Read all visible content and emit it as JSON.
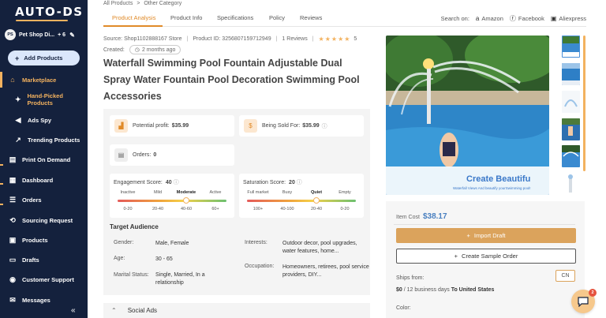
{
  "brand": {
    "logo_text": "AUTO-DS"
  },
  "store": {
    "avatar_text": "PS",
    "name": "Pet Shop Di...",
    "extra_count": "+ 6"
  },
  "sidebar": {
    "add_products": "Add Products",
    "items": [
      {
        "label": "Marketplace",
        "icon": "shop-icon"
      },
      {
        "label": "Hand-Picked Products",
        "icon": "star-icon"
      },
      {
        "label": "Ads Spy",
        "icon": "megaphone-icon"
      },
      {
        "label": "Trending Products",
        "icon": "trend-icon"
      },
      {
        "label": "Print On Demand",
        "icon": "printer-icon"
      },
      {
        "label": "Dashboard",
        "icon": "dashboard-icon"
      },
      {
        "label": "Orders",
        "icon": "orders-icon"
      },
      {
        "label": "Sourcing Request",
        "icon": "sourcing-icon"
      },
      {
        "label": "Products",
        "icon": "box-icon"
      },
      {
        "label": "Drafts",
        "icon": "drafts-icon"
      },
      {
        "label": "Customer Support",
        "icon": "support-icon"
      },
      {
        "label": "Messages",
        "icon": "message-icon"
      }
    ],
    "collapse_icon": "«"
  },
  "breadcrumb": {
    "items": [
      "All Products",
      ">",
      "Other Category"
    ]
  },
  "tabs": [
    "Product Analysis",
    "Product Info",
    "Specifications",
    "Policy",
    "Reviews"
  ],
  "search_on": {
    "label": "Search on:",
    "links": [
      "Amazon",
      "Facebook",
      "Aliexpress"
    ]
  },
  "meta": {
    "source": "Source: Shop1102888167 Store",
    "product_id": "Product ID: 3256807159712949",
    "reviews": "1 Reviews",
    "stars": "★★★★★",
    "rating": "5",
    "created_label": "Created:",
    "created_value": "2 months ago"
  },
  "product": {
    "title": "Waterfall Swimming Pool Fountain Adjustable Dual Spray Water Fountain Pool Decoration Swimming Pool Accessories"
  },
  "analysis": {
    "potential_profit_label": "Potential profit:",
    "potential_profit_value": "$35.99",
    "sold_for_label": "Being Sold For:",
    "sold_for_value": "$35.99",
    "orders_label": "Orders:",
    "orders_value": "0",
    "engagement": {
      "label": "Engagement Score:",
      "value": "40",
      "levels": [
        "Inactive",
        "Mild",
        "Moderate",
        "Active"
      ],
      "ranges": [
        "0-20",
        "20-40",
        "40-60",
        "60+"
      ],
      "selected": "Moderate"
    },
    "saturation": {
      "label": "Saturation Score:",
      "value": "20",
      "levels": [
        "Full market",
        "Busy",
        "Quiet",
        "Empty"
      ],
      "ranges": [
        "100+",
        "40-100",
        "20-40",
        "0-20"
      ],
      "selected": "Quiet"
    }
  },
  "audience": {
    "title": "Target Audience",
    "gender_label": "Gender:",
    "gender_value": "Male, Female",
    "age_label": "Age:",
    "age_value": "30 - 65",
    "marital_label": "Marital Status:",
    "marital_value": "Single, Married, In a relationship",
    "interests_label": "Interests:",
    "interests_value": "Outdoor decor, pool upgrades, water features, home...",
    "occupation_label": "Occupation:",
    "occupation_value": "Homeowners, retirees, pool service providers, DIY..."
  },
  "social_ads": {
    "label": "Social Ads"
  },
  "image": {
    "caption": "Create Beautifu",
    "subcaption": "Waterfall Views And beautify yourSwimming pool!"
  },
  "purchase": {
    "item_cost_label": "Item Cost",
    "item_cost_value": "$38.17",
    "import_label": "Import Draft",
    "sample_label": "Create Sample Order",
    "ships_from_label": "Ships from:",
    "ships_from_value": "CN",
    "shipping_price": "$0",
    "shipping_days": "/ 12 business days",
    "shipping_dest": "To United States",
    "color_label": "Color:"
  },
  "chat": {
    "badge_count": "2"
  },
  "colors": {
    "sidebar_bg": "#14213d",
    "accent": "#f3b25f",
    "tab_active": "#e08a28",
    "price": "#4a80c0"
  }
}
